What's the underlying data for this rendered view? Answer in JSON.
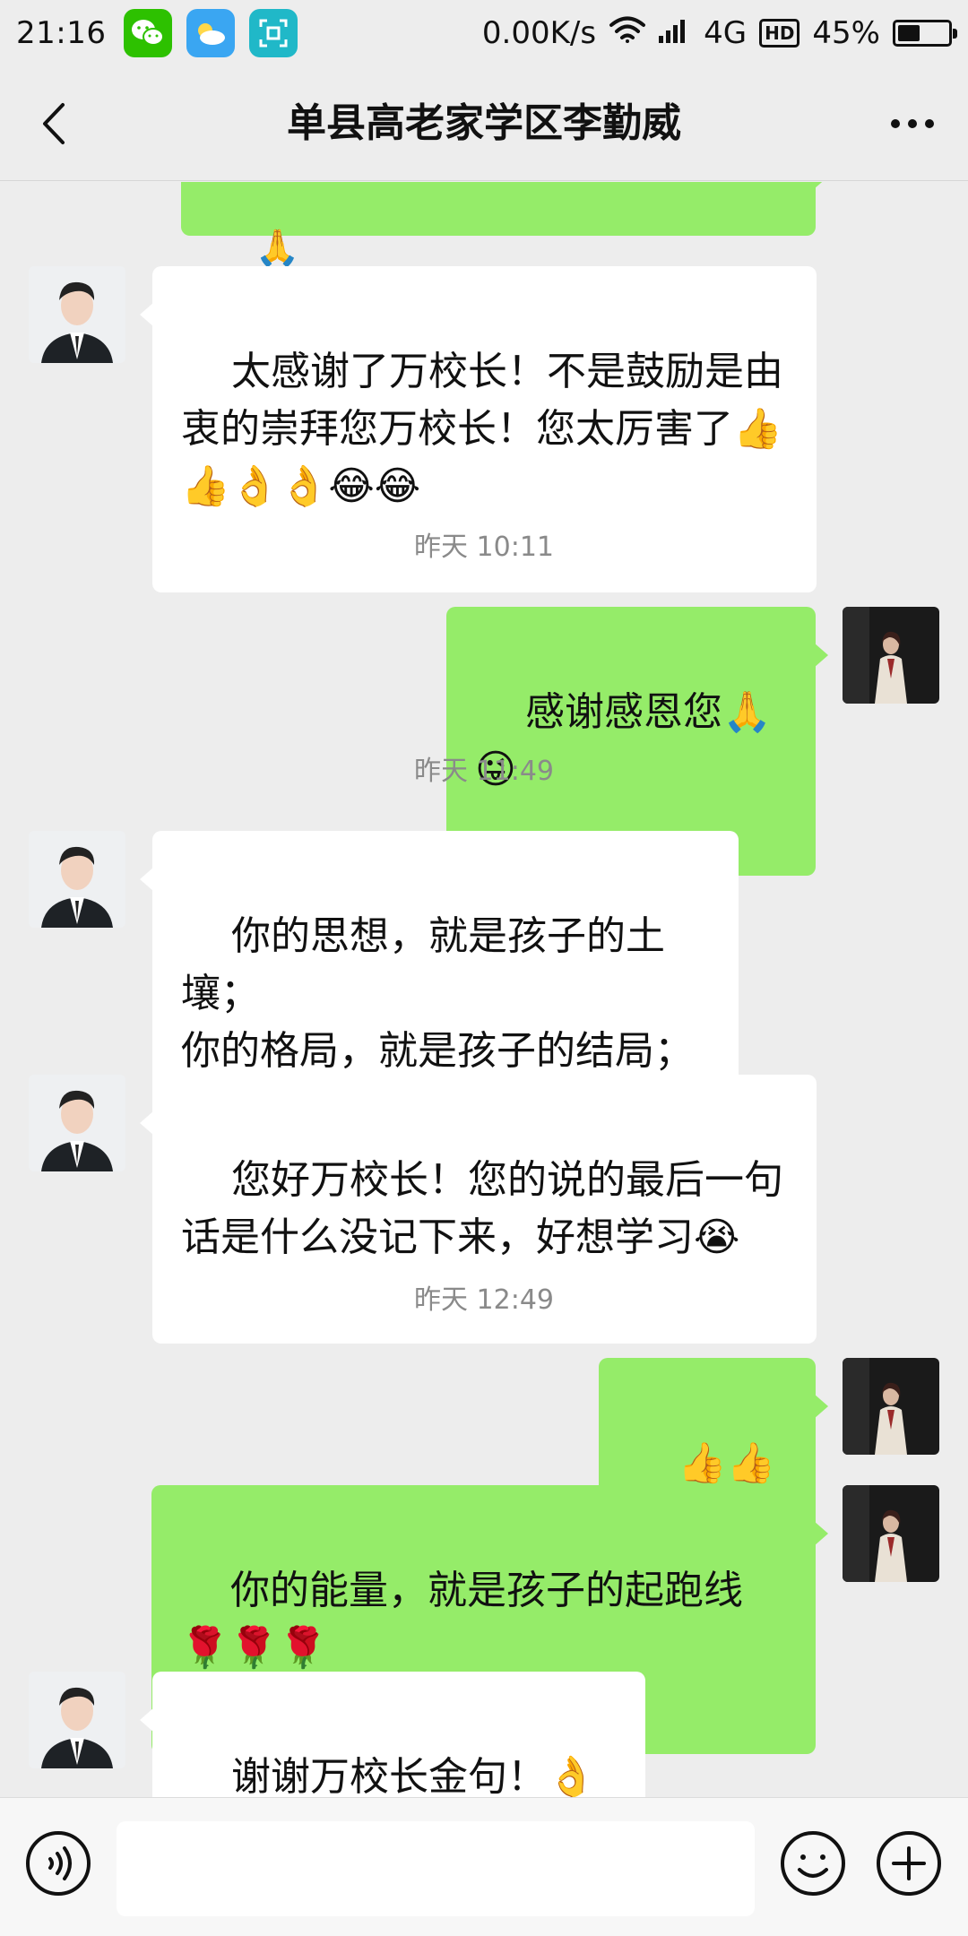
{
  "status_bar": {
    "time": "21:16",
    "net_speed": "0.00K/s",
    "network": "4G",
    "hd": "HD",
    "battery": "45%",
    "battery_level": 0.45,
    "icons": [
      "wechat-icon",
      "weather-icon",
      "scan-icon",
      "wifi-icon",
      "signal-icon"
    ]
  },
  "header": {
    "title": "单县高老家学区李勤威",
    "icons": [
      "back-arrow-icon",
      "more-icon"
    ]
  },
  "messages": {
    "m0": {
      "side": "out",
      "text": "🙏"
    },
    "m1": {
      "side": "in",
      "text": "太感谢了万校长！不是鼓励是由衷的崇拜您万校长！您太厉害了👍👍👌👌😂😂"
    },
    "ts1": "昨天 10:11",
    "m2": {
      "side": "out",
      "text": "感谢感恩您🙏😜"
    },
    "ts2": "昨天 11:49",
    "m3": {
      "side": "in",
      "text": "你的思想，就是孩子的土壤；\n你的格局，就是孩子的结局；\n你的能量，就是孩子的（ ）。"
    },
    "m4": {
      "side": "in",
      "text": "您好万校长！您的说的最后一句话是什么没记下来，好想学习😭"
    },
    "ts3": "昨天 12:49",
    "m5": {
      "side": "out",
      "text": "👍👍👍"
    },
    "m6": {
      "side": "out",
      "text": "你的能量，就是孩子的起跑线🌹🌹🌹"
    },
    "m7": {
      "side": "in",
      "text": "谢谢万校长金句！👌👌"
    }
  },
  "input_bar": {
    "value": "",
    "icons": [
      "voice-icon",
      "emoji-icon",
      "plus-icon"
    ]
  },
  "colors": {
    "background": "#ededed",
    "bubble_in": "#ffffff",
    "bubble_out": "#95ec69",
    "timestamp": "#8a8a8a"
  }
}
